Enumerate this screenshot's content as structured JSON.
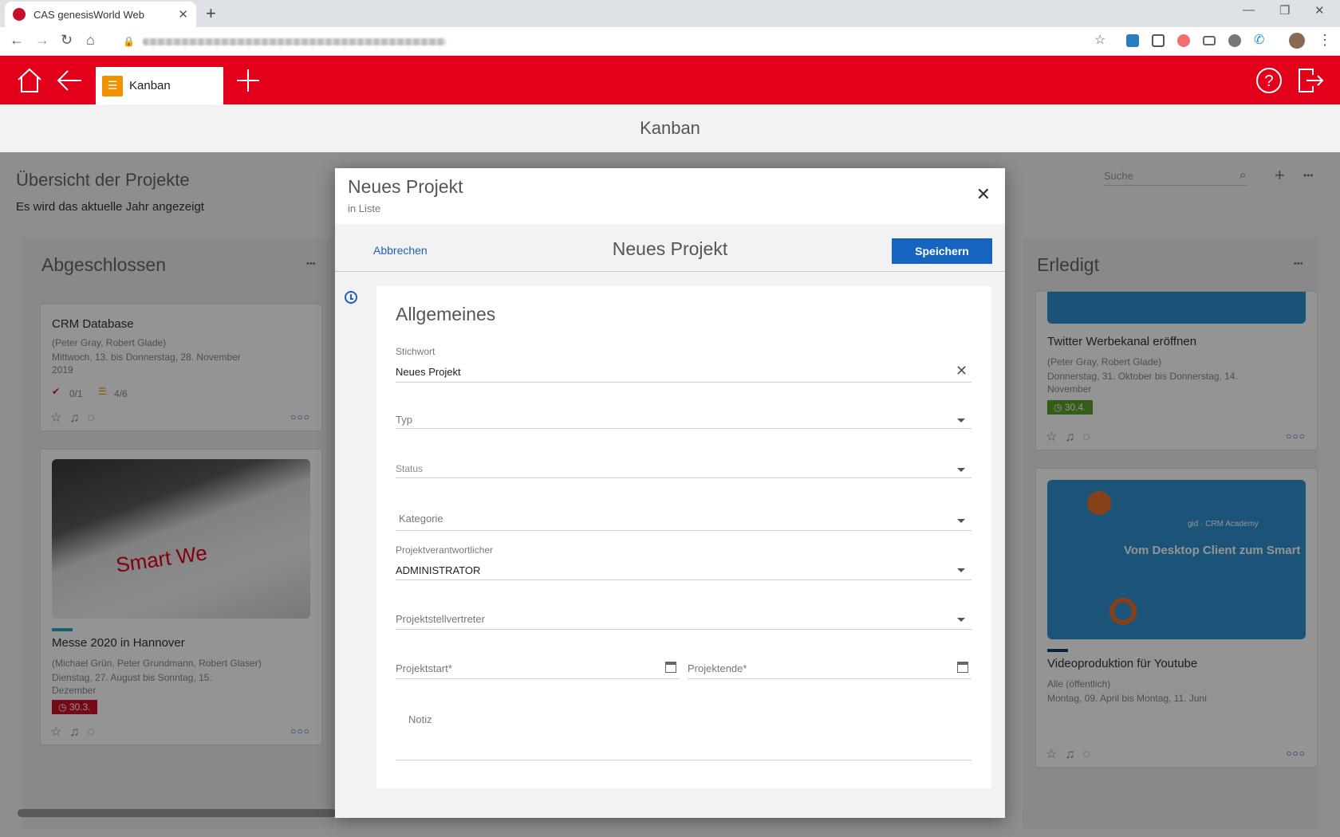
{
  "browser": {
    "tab_title": "CAS genesisWorld Web",
    "tab_close": "✕",
    "new_tab": "+"
  },
  "app": {
    "tab_label": "Kanban",
    "page_title": "Kanban"
  },
  "background": {
    "heading": "Übersicht der Projekte",
    "subheading": "Es wird das aktuelle Jahr angezeigt",
    "search_placeholder": "Suche",
    "columns": [
      {
        "title": "Abgeschlossen",
        "cards": [
          {
            "title": "CRM Database",
            "people": "(Peter Gray, Robert Glade)",
            "dates": "Mittwoch, 13. bis Donnerstag, 28. November 2019",
            "tasks": "0/1",
            "subtasks": "4/6"
          },
          {
            "title": "Messe 2020 in Hannover",
            "people": "(Michael Grün, Peter Grundmann, Robert Glaser)",
            "dates": "Dienstag, 27. August  bis Sonntag, 15. Dezember",
            "badge": "30.3."
          }
        ]
      },
      {
        "title": "Erledigt",
        "cards": [
          {
            "title": "Twitter Werbekanal eröffnen",
            "people": "(Peter Gray, Robert Glade)",
            "dates": "Donnerstag, 31. Oktober  bis Donnerstag, 14. November",
            "badge": "30.4."
          },
          {
            "title": "Videoproduktion für Youtube",
            "people": "Alle (öffentlich)",
            "dates": "Montag, 09. April  bis Montag, 11. Juni",
            "image_caption": "gid · CRM Academy",
            "image_title": "Vom Desktop Client zum Smart"
          }
        ]
      }
    ]
  },
  "modal": {
    "title": "Neues Projekt",
    "subtitle": "in Liste",
    "cancel_label": "Abbrechen",
    "bar_title": "Neues Projekt",
    "save_label": "Speichern",
    "section_title": "Allgemeines",
    "fields": {
      "stichwort_label": "Stichwort",
      "stichwort_value": "Neues Projekt",
      "typ_placeholder": "Typ",
      "status_placeholder": "Status",
      "kategorie_placeholder": "Kategorie",
      "verantwortlicher_label": "Projektverantwortlicher",
      "verantwortlicher_value": "ADMINISTRATOR",
      "stellvertreter_placeholder": "Projektstellvertreter",
      "start_placeholder": "Projektstart*",
      "ende_placeholder": "Projektende*",
      "notiz_placeholder": "Notiz"
    }
  },
  "colors": {
    "brand_red": "#e2001a",
    "primary_blue": "#1565c0",
    "kanban_orange": "#f39200"
  }
}
